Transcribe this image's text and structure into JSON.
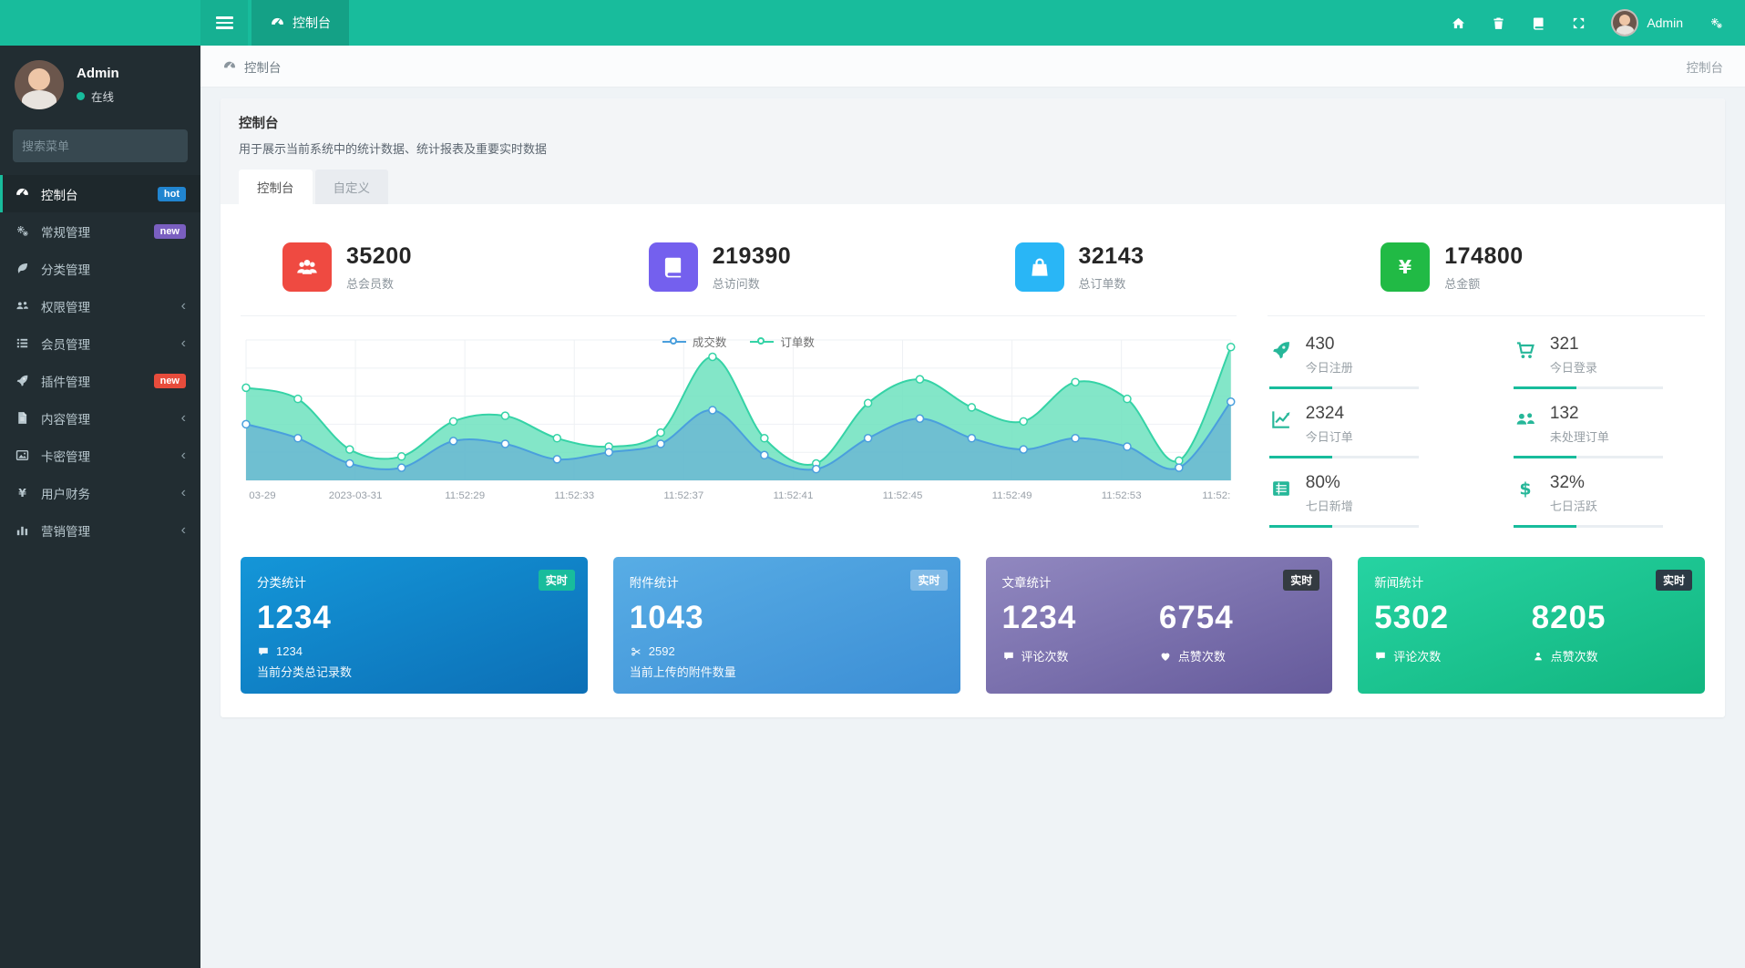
{
  "navbar": {
    "brand_tab": {
      "label": "控制台",
      "icon": "gauge"
    },
    "right_icons": [
      "home",
      "trash",
      "docs",
      "fullscreen"
    ],
    "user": {
      "name": "Admin"
    },
    "settings_icon": "gears"
  },
  "sidebar": {
    "user": {
      "name": "Admin",
      "status": "在线"
    },
    "search_placeholder": "搜索菜单",
    "items": [
      {
        "label": "控制台",
        "icon": "gauge",
        "badge": "hot",
        "badge_color": "#2185d0",
        "active": true
      },
      {
        "label": "常规管理",
        "icon": "gears",
        "badge": "new",
        "badge_color": "#7a5fc0"
      },
      {
        "label": "分类管理",
        "icon": "leaf"
      },
      {
        "label": "权限管理",
        "icon": "users",
        "chevron": "‹"
      },
      {
        "label": "会员管理",
        "icon": "list",
        "chevron": "‹"
      },
      {
        "label": "插件管理",
        "icon": "rocket",
        "badge": "new",
        "badge_color": "#e74c3c"
      },
      {
        "label": "内容管理",
        "icon": "file",
        "chevron": "‹"
      },
      {
        "label": "卡密管理",
        "icon": "image",
        "chevron": "‹"
      },
      {
        "label": "用户财务",
        "icon": "yen",
        "chevron": "‹"
      },
      {
        "label": "营销管理",
        "icon": "bar-chart",
        "chevron": "‹"
      }
    ]
  },
  "breadcrumb": {
    "left": "控制台",
    "right": "控制台"
  },
  "panel": {
    "title": "控制台",
    "description": "用于展示当前系统中的统计数据、统计报表及重要实时数据",
    "tabs": [
      {
        "label": "控制台",
        "active": true
      },
      {
        "label": "自定义",
        "active": false
      }
    ]
  },
  "stats": [
    {
      "value": "35200",
      "label": "总会员数",
      "icon": "members",
      "color": "#ef4a41"
    },
    {
      "value": "219390",
      "label": "总访问数",
      "icon": "book",
      "color": "#7460ee"
    },
    {
      "value": "32143",
      "label": "总订单数",
      "icon": "shopping-bag",
      "color": "#29b6f6"
    },
    {
      "value": "174800",
      "label": "总金额",
      "icon": "yen",
      "color": "#21ba45"
    }
  ],
  "chart_data": {
    "type": "area",
    "categories": [
      "03-29",
      "2023-03-31",
      "11:52:29",
      "11:52:33",
      "11:52:37",
      "11:52:41",
      "11:52:45",
      "11:52:49",
      "11:52:53",
      "11:52:"
    ],
    "series": [
      {
        "name": "成交数",
        "color": "#4a9fdd",
        "fill": "rgba(94,158,216,0.55)",
        "values": [
          40,
          30,
          12,
          9,
          28,
          26,
          15,
          20,
          26,
          50,
          18,
          8,
          30,
          44,
          30,
          22,
          30,
          24,
          9,
          56
        ]
      },
      {
        "name": "订单数",
        "color": "#35d3a6",
        "fill": "rgba(109,226,190,0.85)",
        "values": [
          66,
          58,
          22,
          17,
          42,
          46,
          30,
          24,
          34,
          88,
          30,
          12,
          55,
          72,
          52,
          42,
          70,
          58,
          14,
          95
        ]
      }
    ],
    "ylim": [
      0,
      100
    ],
    "grid": true,
    "legend_position": "top"
  },
  "mini_stats": [
    {
      "value": "430",
      "label": "今日注册",
      "icon": "rocket",
      "progress": 42
    },
    {
      "value": "321",
      "label": "今日登录",
      "icon": "cart",
      "progress": 42
    },
    {
      "value": "2324",
      "label": "今日订单",
      "icon": "line-chart",
      "progress": 42
    },
    {
      "value": "132",
      "label": "未处理订单",
      "icon": "users",
      "progress": 42
    },
    {
      "value": "80%",
      "label": "七日新增",
      "icon": "table",
      "progress": 42
    },
    {
      "value": "32%",
      "label": "七日活跃",
      "icon": "dollar",
      "progress": 42
    }
  ],
  "cards": [
    {
      "title": "分类统计",
      "badge": "实时",
      "badge_bg": "#18bc9c",
      "value": "1234",
      "sub_icon": "comment",
      "sub_value": "1234",
      "label": "当前分类总记录数",
      "bg": [
        "#1496d8",
        "#0c6fb6"
      ]
    },
    {
      "title": "附件统计",
      "badge": "实时",
      "badge_bg": "rgba(255,255,255,0.3)",
      "value": "1043",
      "sub_icon": "scissors",
      "sub_value": "2592",
      "label": "当前上传的附件数量",
      "bg": [
        "#58ade5",
        "#3c8ed5"
      ]
    },
    {
      "title": "文章统计",
      "badge": "实时",
      "badge_bg": "#343b41",
      "bg": [
        "#9188c0",
        "#655a9b"
      ],
      "metrics": [
        {
          "value": "1234",
          "icon": "comment",
          "label": "评论次数"
        },
        {
          "value": "6754",
          "icon": "heart",
          "label": "点赞次数"
        }
      ]
    },
    {
      "title": "新闻统计",
      "badge": "实时",
      "badge_bg": "#2c3a45",
      "bg": [
        "#26d3a2",
        "#12b57f"
      ],
      "metrics": [
        {
          "value": "5302",
          "icon": "comment",
          "label": "评论次数"
        },
        {
          "value": "8205",
          "icon": "user",
          "label": "点赞次数"
        }
      ]
    }
  ]
}
